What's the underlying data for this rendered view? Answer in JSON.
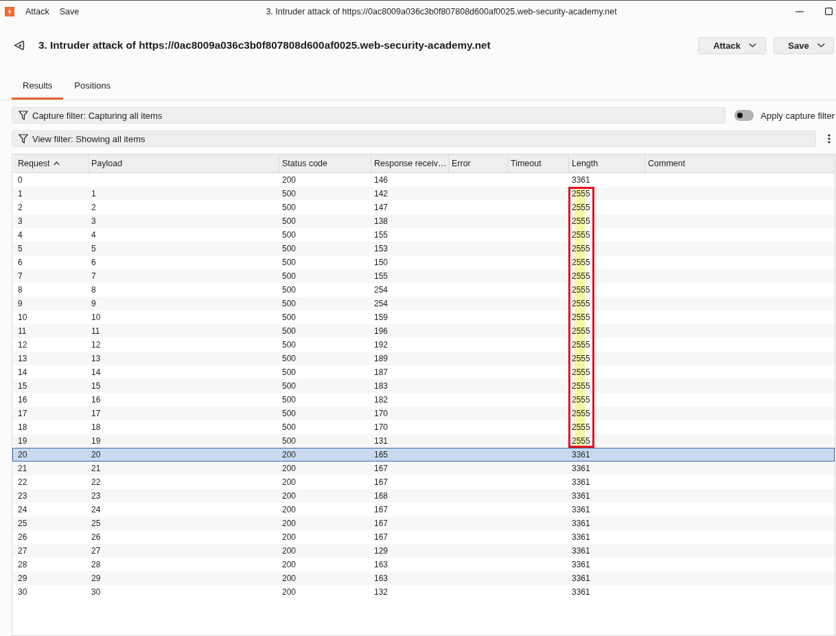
{
  "title_bar": {
    "menu": [
      "Attack",
      "Save"
    ],
    "title": "3. Intruder attack of https://0ac8009a036c3b0f807808d600af0025.web-security-academy.net"
  },
  "header": {
    "title": "3. Intruder attack of https://0ac8009a036c3b0f807808d600af0025.web-security-academy.net",
    "buttons": [
      "Attack",
      "Save"
    ]
  },
  "tabs": [
    {
      "label": "Results",
      "selected": true
    },
    {
      "label": "Positions",
      "selected": false
    }
  ],
  "capture_filter": {
    "label": "Capture filter: Capturing all items",
    "toggle": {
      "label": "Apply capture filter",
      "on": false
    }
  },
  "view_filter": {
    "label": "View filter: Showing all items"
  },
  "table": {
    "columns": [
      {
        "label": "Request",
        "sort_ascending": true
      },
      {
        "label": "Payload"
      },
      {
        "label": "Status code"
      },
      {
        "label": "Response receiv…"
      },
      {
        "label": "Error"
      },
      {
        "label": "Timeout"
      },
      {
        "label": "Length"
      },
      {
        "label": "Comment"
      }
    ],
    "rows": [
      {
        "request": "0",
        "status_code": "200",
        "response_received": "146",
        "length": "3361",
        "selected": false,
        "marked": false
      },
      {
        "request": "1",
        "payload": "1",
        "status_code": "500",
        "response_received": "142",
        "length": "2555",
        "selected": false,
        "marked": true
      },
      {
        "request": "2",
        "payload": "2",
        "status_code": "500",
        "response_received": "147",
        "length": "2555",
        "selected": false,
        "marked": true
      },
      {
        "request": "3",
        "payload": "3",
        "status_code": "500",
        "response_received": "138",
        "length": "2555",
        "selected": false,
        "marked": true
      },
      {
        "request": "4",
        "payload": "4",
        "status_code": "500",
        "response_received": "155",
        "length": "2555",
        "selected": false,
        "marked": true
      },
      {
        "request": "5",
        "payload": "5",
        "status_code": "500",
        "response_received": "153",
        "length": "2555",
        "selected": false,
        "marked": true
      },
      {
        "request": "6",
        "payload": "6",
        "status_code": "500",
        "response_received": "150",
        "length": "2555",
        "selected": false,
        "marked": true
      },
      {
        "request": "7",
        "payload": "7",
        "status_code": "500",
        "response_received": "155",
        "length": "2555",
        "selected": false,
        "marked": true
      },
      {
        "request": "8",
        "payload": "8",
        "status_code": "500",
        "response_received": "254",
        "length": "2555",
        "selected": false,
        "marked": true
      },
      {
        "request": "9",
        "payload": "9",
        "status_code": "500",
        "response_received": "254",
        "length": "2555",
        "selected": false,
        "marked": true
      },
      {
        "request": "10",
        "payload": "10",
        "status_code": "500",
        "response_received": "159",
        "length": "2555",
        "selected": false,
        "marked": true
      },
      {
        "request": "11",
        "payload": "11",
        "status_code": "500",
        "response_received": "196",
        "length": "2555",
        "selected": false,
        "marked": true
      },
      {
        "request": "12",
        "payload": "12",
        "status_code": "500",
        "response_received": "192",
        "length": "2555",
        "selected": false,
        "marked": true
      },
      {
        "request": "13",
        "payload": "13",
        "status_code": "500",
        "response_received": "189",
        "length": "2555",
        "selected": false,
        "marked": true
      },
      {
        "request": "14",
        "payload": "14",
        "status_code": "500",
        "response_received": "187",
        "length": "2555",
        "selected": false,
        "marked": true
      },
      {
        "request": "15",
        "payload": "15",
        "status_code": "500",
        "response_received": "183",
        "length": "2555",
        "selected": false,
        "marked": true
      },
      {
        "request": "16",
        "payload": "16",
        "status_code": "500",
        "response_received": "182",
        "length": "2555",
        "selected": false,
        "marked": true
      },
      {
        "request": "17",
        "payload": "17",
        "status_code": "500",
        "response_received": "170",
        "length": "2555",
        "selected": false,
        "marked": true
      },
      {
        "request": "18",
        "payload": "18",
        "status_code": "500",
        "response_received": "170",
        "length": "2555",
        "selected": false,
        "marked": true
      },
      {
        "request": "19",
        "payload": "19",
        "status_code": "500",
        "response_received": "131",
        "length": "2555",
        "selected": false,
        "marked": true
      },
      {
        "request": "20",
        "payload": "20",
        "status_code": "200",
        "response_received": "165",
        "length": "3361",
        "selected": true,
        "marked": false
      },
      {
        "request": "21",
        "payload": "21",
        "status_code": "200",
        "response_received": "167",
        "length": "3361",
        "selected": false,
        "marked": false
      },
      {
        "request": "22",
        "payload": "22",
        "status_code": "200",
        "response_received": "167",
        "length": "3361",
        "selected": false,
        "marked": false
      },
      {
        "request": "23",
        "payload": "23",
        "status_code": "200",
        "response_received": "168",
        "length": "3361",
        "selected": false,
        "marked": false
      },
      {
        "request": "24",
        "payload": "24",
        "status_code": "200",
        "response_received": "167",
        "length": "3361",
        "selected": false,
        "marked": false
      },
      {
        "request": "25",
        "payload": "25",
        "status_code": "200",
        "response_received": "167",
        "length": "3361",
        "selected": false,
        "marked": false
      },
      {
        "request": "26",
        "payload": "26",
        "status_code": "200",
        "response_received": "167",
        "length": "3361",
        "selected": false,
        "marked": false
      },
      {
        "request": "27",
        "payload": "27",
        "status_code": "200",
        "response_received": "129",
        "length": "3361",
        "selected": false,
        "marked": false
      },
      {
        "request": "28",
        "payload": "28",
        "status_code": "200",
        "response_received": "163",
        "length": "3361",
        "selected": false,
        "marked": false
      },
      {
        "request": "29",
        "payload": "29",
        "status_code": "200",
        "response_received": "163",
        "length": "3361",
        "selected": false,
        "marked": false
      },
      {
        "request": "30",
        "payload": "30",
        "status_code": "200",
        "response_received": "132",
        "length": "3361",
        "selected": false,
        "marked": false
      }
    ]
  }
}
